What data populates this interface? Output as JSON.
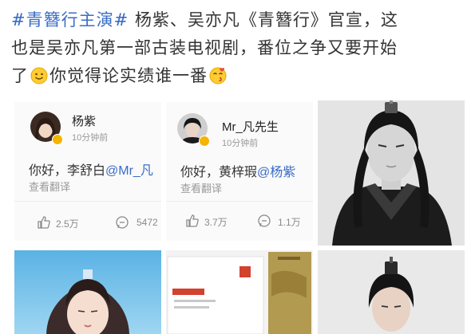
{
  "post": {
    "hashtag": "#青簪行主演#",
    "line1_rest": " 杨紫、吴亦凡《青簪行》官宣，这",
    "line2": "也是吴亦凡第一部古装电视剧，番位之争又要开始",
    "line3_a": "了",
    "line3_b": "你觉得论实绩谁一番",
    "emoji_1": "smile-emoji",
    "emoji_2": "kiss-emoji"
  },
  "cards": [
    {
      "user": "杨紫",
      "time": "10分钟前",
      "greeting": "你好，李舒白",
      "mention": "@Mr_凡",
      "translate": "查看翻译",
      "likes": "2.5万",
      "comments": "5472"
    },
    {
      "user": "Mr_凡先生",
      "time": "10分钟前",
      "greeting": "你好，黄梓瑕",
      "mention": "@杨紫",
      "translate": "查看翻译",
      "likes": "3.7万",
      "comments": "1.1万"
    }
  ],
  "colors": {
    "link": "#3a6cc6",
    "badge": "#f5b400"
  },
  "icons": [
    "like-icon",
    "comment-icon",
    "verified-badge-icon"
  ]
}
